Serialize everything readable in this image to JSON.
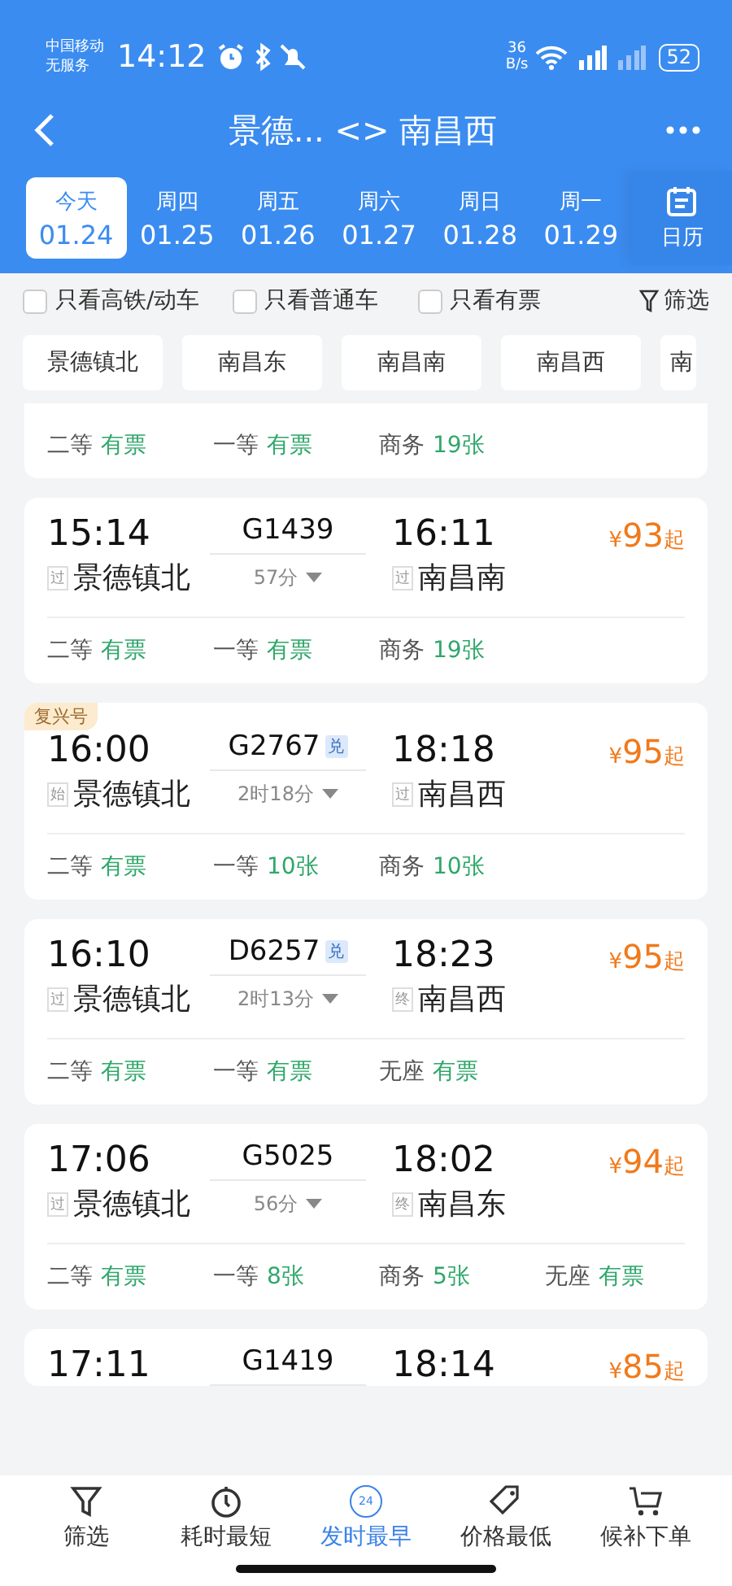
{
  "status_bar": {
    "carrier": "中国移动",
    "service": "无服务",
    "time": "14:12",
    "speed_value": "36",
    "speed_unit": "B/s",
    "battery": "52"
  },
  "header": {
    "title": "景德... <> 南昌西"
  },
  "dates": [
    {
      "weekday": "今天",
      "date": "01.24",
      "selected": true
    },
    {
      "weekday": "周四",
      "date": "01.25",
      "selected": false
    },
    {
      "weekday": "周五",
      "date": "01.26",
      "selected": false
    },
    {
      "weekday": "周六",
      "date": "01.27",
      "selected": false
    },
    {
      "weekday": "周日",
      "date": "01.28",
      "selected": false
    },
    {
      "weekday": "周一",
      "date": "01.29",
      "selected": false
    }
  ],
  "calendar_label": "日历",
  "filters": [
    {
      "label": "只看高铁/动车",
      "checked": false
    },
    {
      "label": "只看普通车",
      "checked": false
    },
    {
      "label": "只看有票",
      "checked": false
    }
  ],
  "filter_button": "筛选",
  "stations": [
    "景德镇北",
    "南昌东",
    "南昌南",
    "南昌西",
    "南"
  ],
  "trains": [
    {
      "seats": [
        {
          "class": "二等",
          "availability": "有票"
        },
        {
          "class": "一等",
          "availability": "有票"
        },
        {
          "class": "商务",
          "availability": "19张"
        }
      ]
    },
    {
      "depart": "15:14",
      "depart_mark": "过",
      "depart_station": "景德镇北",
      "code": "G1439",
      "duration": "57分",
      "arrive": "16:11",
      "arrive_mark": "过",
      "arrive_station": "南昌南",
      "price_symbol": "¥",
      "price": "93",
      "price_suffix": "起",
      "seats": [
        {
          "class": "二等",
          "availability": "有票"
        },
        {
          "class": "一等",
          "availability": "有票"
        },
        {
          "class": "商务",
          "availability": "19张"
        }
      ]
    },
    {
      "tag": "复兴号",
      "depart": "16:00",
      "depart_mark": "始",
      "depart_station": "景德镇北",
      "code": "G2767",
      "code_badge": "兑",
      "duration": "2时18分",
      "arrive": "18:18",
      "arrive_mark": "过",
      "arrive_station": "南昌西",
      "price_symbol": "¥",
      "price": "95",
      "price_suffix": "起",
      "seats": [
        {
          "class": "二等",
          "availability": "有票"
        },
        {
          "class": "一等",
          "availability": "10张"
        },
        {
          "class": "商务",
          "availability": "10张"
        }
      ]
    },
    {
      "depart": "16:10",
      "depart_mark": "过",
      "depart_station": "景德镇北",
      "code": "D6257",
      "code_badge": "兑",
      "duration": "2时13分",
      "arrive": "18:23",
      "arrive_mark": "终",
      "arrive_station": "南昌西",
      "price_symbol": "¥",
      "price": "95",
      "price_suffix": "起",
      "seats": [
        {
          "class": "二等",
          "availability": "有票"
        },
        {
          "class": "一等",
          "availability": "有票"
        },
        {
          "class": "无座",
          "availability": "有票"
        }
      ]
    },
    {
      "depart": "17:06",
      "depart_mark": "过",
      "depart_station": "景德镇北",
      "code": "G5025",
      "duration": "56分",
      "arrive": "18:02",
      "arrive_mark": "终",
      "arrive_station": "南昌东",
      "price_symbol": "¥",
      "price": "94",
      "price_suffix": "起",
      "seats": [
        {
          "class": "二等",
          "availability": "有票"
        },
        {
          "class": "一等",
          "availability": "8张"
        },
        {
          "class": "商务",
          "availability": "5张"
        },
        {
          "class": "无座",
          "availability": "有票"
        }
      ]
    },
    {
      "depart": "17:11",
      "code": "G1419",
      "arrive": "18:14",
      "price_symbol": "¥",
      "price": "85",
      "price_suffix": "起"
    }
  ],
  "bottom_nav": [
    {
      "kind": "filter",
      "label": "筛选",
      "selected": false
    },
    {
      "kind": "timer",
      "label": "耗时最短",
      "selected": false
    },
    {
      "kind": "date",
      "icon_text": "24",
      "label": "发时最早",
      "selected": true
    },
    {
      "kind": "tag",
      "label": "价格最低",
      "selected": false
    },
    {
      "kind": "cart",
      "label": "候补下单",
      "selected": false
    }
  ]
}
